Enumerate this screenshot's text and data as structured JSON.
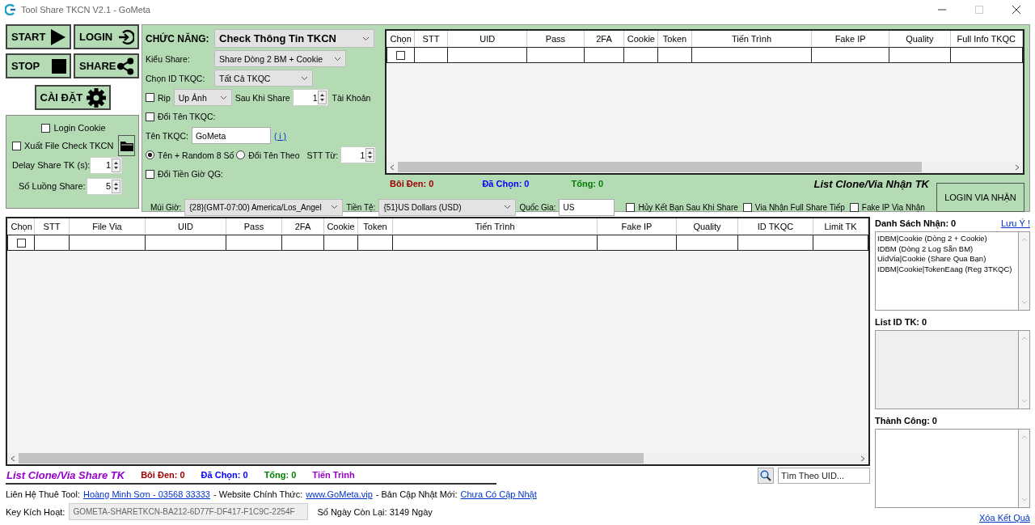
{
  "window": {
    "title": "Tool Share TKCN V2.1 - GoMeta"
  },
  "action_buttons": [
    {
      "label": "START",
      "kind": "play"
    },
    {
      "label": "LOGIN",
      "kind": "login"
    },
    {
      "label": "STOP",
      "kind": "stop"
    },
    {
      "label": "SHARE",
      "kind": "share"
    },
    {
      "label": "CÀI ĐẶT",
      "kind": "settings"
    }
  ],
  "options": {
    "login_cookie": {
      "label": "Login Cookie",
      "checked": false
    },
    "export_file": {
      "label": "Xuất File Check TKCN",
      "checked": false
    },
    "delay": {
      "label": "Delay Share TK (s):",
      "value": "1"
    },
    "threads": {
      "label": "Số Luồng Share:",
      "value": "5"
    }
  },
  "function_panel": {
    "function": {
      "label": "CHỨC NĂNG:",
      "value": "Check Thông Tin TKCN"
    },
    "share_type": {
      "label": "Kiểu Share:",
      "value": "Share Dòng 2 BM + Cookie"
    },
    "ad_account": {
      "label": "Chọn ID TKQC:",
      "value": "Tất Cả TKQC"
    },
    "rip": {
      "label": "Rip",
      "checked": false,
      "mode": "Up Ảnh",
      "after_label": "Sau Khi Share",
      "count": "1",
      "unit": "Tài Khoản"
    },
    "rename": {
      "label": "Đổi Tên TKQC:",
      "checked": false
    },
    "account_name": {
      "label": "Tên TKQC:",
      "value": "GoMeta",
      "info_link": "( i )"
    },
    "rename_modes": [
      {
        "label": "Tên + Random 8 Số",
        "selected": true
      },
      {
        "label": "Đổi Tên Theo",
        "selected": false
      }
    ],
    "start_index": {
      "label": "STT Từ:",
      "value": "1"
    },
    "change_currency_tz": {
      "label": "Đổi Tiền Giờ QG:",
      "checked": false
    },
    "timezone": {
      "label": "Múi Giờ:",
      "value": "{28}(GMT-07:00) America/Los_Angel"
    },
    "currency": {
      "label": "Tiền Tệ:",
      "value": "{51}US Dollars (USD)"
    },
    "country": {
      "label": "Quốc Gia:",
      "value": "US"
    }
  },
  "receive_table": {
    "columns": [
      "Chọn",
      "STT",
      "UID",
      "Pass",
      "2FA",
      "Cookie",
      "Token",
      "Tiến Trình",
      "Fake IP",
      "Quality",
      "Full Info TKQC"
    ],
    "rows": [
      {
        "checked": false
      }
    ],
    "stats": [
      {
        "text": "Bôi Đen: 0",
        "color": "#a00000"
      },
      {
        "text": "Đã Chọn: 0",
        "color": "#0000ff"
      },
      {
        "text": "Tổng: 0",
        "color": "#008000"
      }
    ],
    "title": "List Clone/Via Nhận TK",
    "options": [
      {
        "label": "Hủy Kết Bạn Sau Khi Share",
        "checked": false
      },
      {
        "label": "Via Nhận Full Share Tiếp",
        "checked": false
      },
      {
        "label": "Fake IP Via Nhận",
        "checked": false
      }
    ],
    "login_button": "LOGIN VIA NHẬN"
  },
  "share_table": {
    "columns": [
      "Chọn",
      "STT",
      "File Via",
      "UID",
      "Pass",
      "2FA",
      "Cookie",
      "Token",
      "Tiến Trình",
      "Fake IP",
      "Quality",
      "ID TKQC",
      "Limit TK"
    ],
    "rows": [
      {
        "checked": false
      }
    ],
    "title": "List Clone/Via Share TK",
    "stats": [
      {
        "text": "Bôi Đen: 0",
        "color": "#a00000"
      },
      {
        "text": "Đã Chọn: 0",
        "color": "#0000ff"
      },
      {
        "text": "Tổng: 0",
        "color": "#008000"
      },
      {
        "text": "Tiến Trình",
        "color": "#9900cc"
      }
    ]
  },
  "search": {
    "placeholder": "Tìm Theo UID..."
  },
  "contact": [
    {
      "kind": "text",
      "text": "Liên Hệ Thuê Tool:"
    },
    {
      "kind": "link",
      "text": "Hoàng Minh Sơn - 03568 33333"
    },
    {
      "kind": "text",
      "text": "- Website Chính Thức:"
    },
    {
      "kind": "link",
      "text": "www.GoMeta.vip"
    },
    {
      "kind": "text",
      "text": "- Bản Cập Nhật Mới:"
    },
    {
      "kind": "link",
      "text": "Chưa Có Cập Nhật"
    }
  ],
  "activation": {
    "label": "Key Kích Hoạt:",
    "key": "GOMETA-SHARETKCN-BA212-6D77F-DF417-F1C9C-2254F",
    "days_left": "Số Ngày Còn Lại: 3149 Ngày"
  },
  "side_panel": {
    "receive_list": {
      "label": "Danh Sách Nhận: 0",
      "note_link": "Lưu Ý !",
      "disabled": false,
      "lines": [
        "IDBM|Cookie (Dòng 2 + Cookie)",
        "IDBM (Dòng 2 Log Sẵn BM)",
        "UidVia|Cookie (Share Qua Bạn)",
        "IDBM|Cookie|TokenEaag (Reg 3TKQC)"
      ]
    },
    "id_list": {
      "label": "List ID TK: 0",
      "disabled": true
    },
    "success_list": {
      "label": "Thành Công: 0",
      "disabled": false
    },
    "clear_link": "Xóa Kết Quả"
  }
}
